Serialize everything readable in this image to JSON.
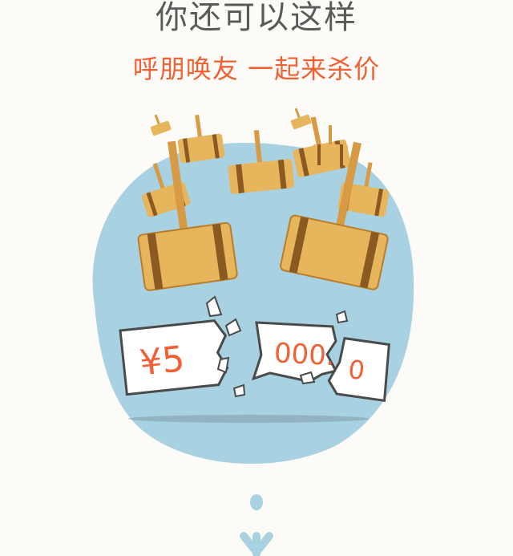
{
  "header": {
    "title": "你还可以这样",
    "subtitle": "呼朋唤友 一起来杀价"
  },
  "illustration": {
    "price_prefix": "¥5",
    "price_middle": "000.",
    "price_suffix": "0",
    "blob_color": "#a8d2e1",
    "hammer_color": "#e7b55b",
    "price_color": "#f06236"
  },
  "scroll_hint": {
    "icon": "arrow-down-icon"
  }
}
